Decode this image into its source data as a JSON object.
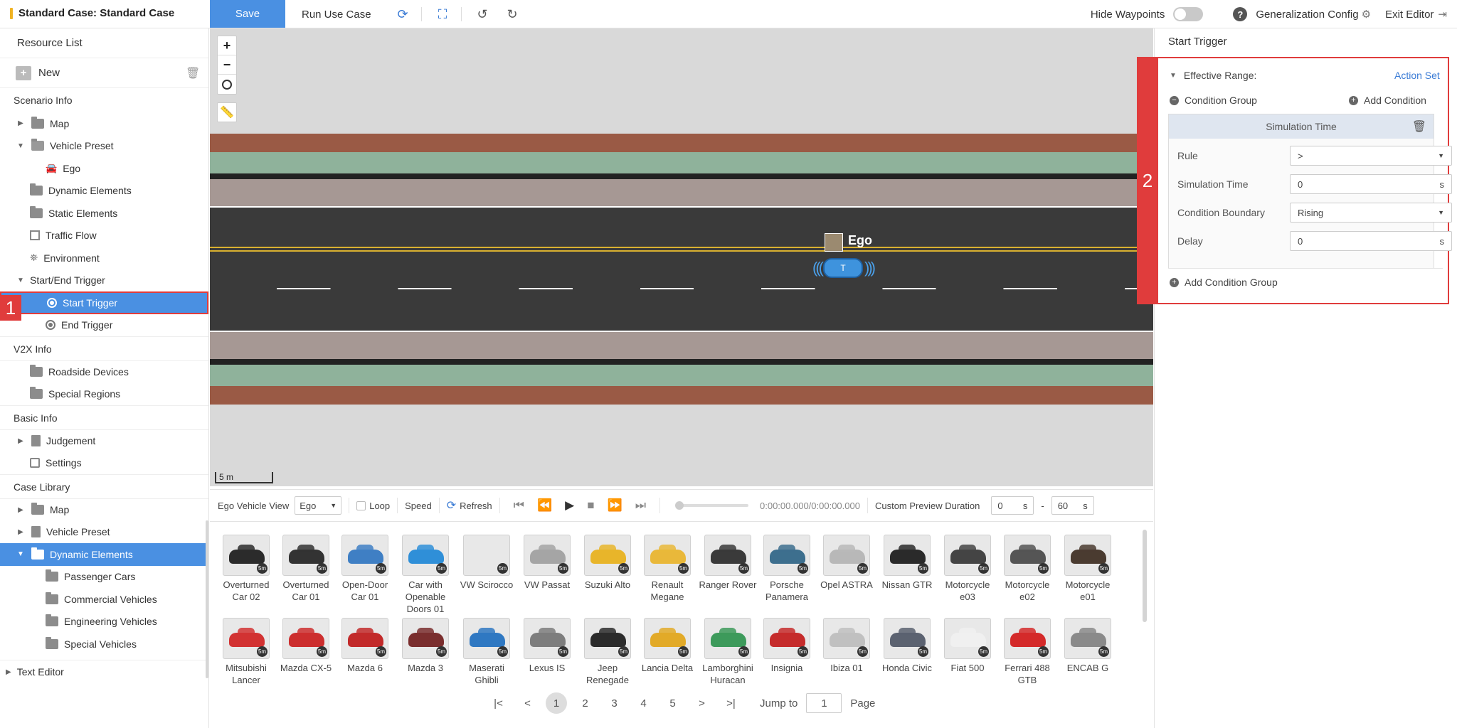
{
  "header": {
    "title": "Standard Case: Standard Case",
    "save_label": "Save",
    "run_label": "Run Use Case",
    "hide_waypoints_label": "Hide Waypoints",
    "generalization_label": "Generalization Config",
    "exit_label": "Exit Editor"
  },
  "sidebar": {
    "resource_list": "Resource List",
    "new_label": "New",
    "scenario_info": {
      "title": "Scenario Info",
      "items": [
        "Map",
        "Vehicle Preset",
        "Ego",
        "Dynamic Elements",
        "Static Elements",
        "Traffic Flow",
        "Environment",
        "Start/End Trigger",
        "Start Trigger",
        "End Trigger"
      ]
    },
    "v2x_info": {
      "title": "V2X Info",
      "items": [
        "Roadside Devices",
        "Special Regions"
      ]
    },
    "basic_info": {
      "title": "Basic Info",
      "items": [
        "Judgement",
        "Settings"
      ]
    },
    "case_library": {
      "title": "Case Library",
      "items": [
        "Map",
        "Vehicle Preset",
        "Dynamic Elements",
        "Passenger Cars",
        "Commercial Vehicles",
        "Engineering Vehicles",
        "Special Vehicles"
      ]
    },
    "text_editor": "Text Editor"
  },
  "annotations": {
    "marker1": "1",
    "marker2": "2"
  },
  "map": {
    "ego_label": "Ego",
    "scale_label": "5 m",
    "zoom_in": "+",
    "zoom_out": "−"
  },
  "playbar": {
    "ego_view_label": "Ego Vehicle View",
    "ego_view_value": "Ego",
    "loop_label": "Loop",
    "speed_label": "Speed",
    "refresh_label": "Refresh",
    "time_display": "0:00:00.000/0:00:00.000",
    "preview_label": "Custom Preview Duration",
    "start_value": "0",
    "end_value": "60",
    "unit": "s",
    "dash": "-"
  },
  "gallery": {
    "badge": "5m",
    "row1": [
      {
        "name": "Overturned Car 02",
        "color": "#2b2b2b"
      },
      {
        "name": "Overturned Car 01",
        "color": "#333333"
      },
      {
        "name": "Open-Door Car 01",
        "color": "#3f7fc4"
      },
      {
        "name": "Car with Openable Doors 01",
        "color": "#2f8fd8"
      },
      {
        "name": "VW Scirocco",
        "color": "#e8e8e8"
      },
      {
        "name": "VW Passat",
        "color": "#a5a5a5"
      },
      {
        "name": "Suzuki Alto",
        "color": "#e8b52a"
      },
      {
        "name": "Renault Megane",
        "color": "#e9b83a"
      },
      {
        "name": "Ranger Rover",
        "color": "#3a3a3a"
      },
      {
        "name": "Porsche Panamera",
        "color": "#3d6f8e"
      },
      {
        "name": "Opel ASTRA",
        "color": "#b8b8b8"
      },
      {
        "name": "Nissan GTR",
        "color": "#2a2a2a"
      },
      {
        "name": "Motorcycle e03",
        "color": "#444444"
      },
      {
        "name": "Motorcycle e02",
        "color": "#555555"
      },
      {
        "name": "Motorcycle e01",
        "color": "#4a3b30"
      }
    ],
    "row2": [
      {
        "name": "Mitsubishi Lancer",
        "color": "#d23232"
      },
      {
        "name": "Mazda CX-5",
        "color": "#cc2e2e"
      },
      {
        "name": "Mazda 6",
        "color": "#c22a2a"
      },
      {
        "name": "Mazda 3",
        "color": "#7a2e2e"
      },
      {
        "name": "Maserati Ghibli",
        "color": "#2f78c2"
      },
      {
        "name": "Lexus IS",
        "color": "#7d7d7d"
      },
      {
        "name": "Jeep Renegade",
        "color": "#2b2b2b"
      },
      {
        "name": "Lancia Delta",
        "color": "#e2aa28"
      },
      {
        "name": "Lamborghini Huracan",
        "color": "#3d9a5b"
      },
      {
        "name": "Insignia",
        "color": "#c52c2c"
      },
      {
        "name": "Ibiza 01",
        "color": "#c0c0c0"
      },
      {
        "name": "Honda Civic",
        "color": "#5b6270"
      },
      {
        "name": "Fiat 500",
        "color": "#f0f0f0"
      },
      {
        "name": "Ferrari 488 GTB",
        "color": "#d42a2a"
      },
      {
        "name": "ENCAB G",
        "color": "#8a8a8a"
      }
    ],
    "pager": {
      "pages": [
        "1",
        "2",
        "3",
        "4",
        "5"
      ],
      "current": "1",
      "jump_label": "Jump to",
      "jump_value": "1",
      "page_label": "Page"
    }
  },
  "right_panel": {
    "title": "Start Trigger",
    "effective_range": "Effective Range:",
    "action_set": "Action Set",
    "condition_group": "Condition Group",
    "add_condition": "Add Condition",
    "condition_title": "Simulation Time",
    "rule_label": "Rule",
    "rule_value": ">",
    "sim_time_label": "Simulation Time",
    "sim_time_value": "0",
    "boundary_label": "Condition Boundary",
    "boundary_value": "Rising",
    "delay_label": "Delay",
    "delay_value": "0",
    "unit": "s",
    "add_condition_group": "Add Condition Group"
  }
}
